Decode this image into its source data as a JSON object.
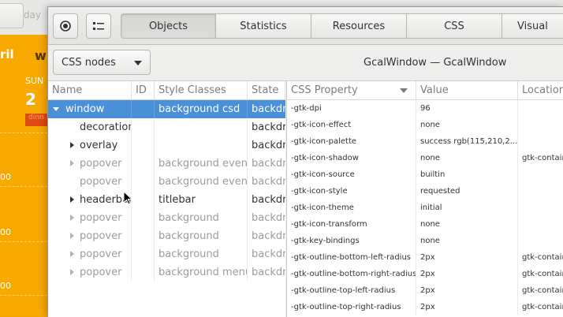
{
  "background_app": {
    "today_label": "day",
    "month_fragment": "ril",
    "view_fragment": "w",
    "day_name": "SUN",
    "day_number": "2",
    "event_fragment": "dinn",
    "hour_fragments": [
      "00",
      "00",
      "00",
      "00"
    ]
  },
  "inspector": {
    "tabs": [
      "Objects",
      "Statistics",
      "Resources",
      "CSS",
      "Visual"
    ],
    "active_tab": "Objects",
    "combo_value": "CSS nodes",
    "window_title": "GcalWindow — GcalWindow",
    "columns": {
      "name": "Name",
      "id": "ID",
      "style_classes": "Style Classes",
      "state": "State"
    },
    "nodes": [
      {
        "name": "window",
        "classes": "background csd",
        "state": "backdrop",
        "expander": "down",
        "selected": true,
        "dim": false
      },
      {
        "name": "decoration",
        "classes": "",
        "state": "backdrop",
        "expander": "none",
        "selected": false,
        "dim": false
      },
      {
        "name": "overlay",
        "classes": "",
        "state": "backdrop",
        "expander": "right",
        "selected": false,
        "dim": false
      },
      {
        "name": "popover",
        "classes": "background events",
        "state": "backdrop",
        "expander": "right",
        "selected": false,
        "dim": true
      },
      {
        "name": "popover",
        "classes": "background events",
        "state": "backdrop",
        "expander": "none",
        "selected": false,
        "dim": true
      },
      {
        "name": "headerbar",
        "classes": "titlebar",
        "state": "backdrop",
        "expander": "right",
        "selected": false,
        "dim": false
      },
      {
        "name": "popover",
        "classes": "background",
        "state": "backdrop",
        "expander": "right",
        "selected": false,
        "dim": true
      },
      {
        "name": "popover",
        "classes": "background",
        "state": "backdrop",
        "expander": "right",
        "selected": false,
        "dim": true
      },
      {
        "name": "popover",
        "classes": "background",
        "state": "backdrop",
        "expander": "right",
        "selected": false,
        "dim": true
      },
      {
        "name": "popover",
        "classes": "background menu",
        "state": "backdrop",
        "expander": "right",
        "selected": false,
        "dim": true
      }
    ],
    "prop_columns": {
      "property": "CSS Property",
      "value": "Value",
      "location": "Location"
    },
    "properties": [
      {
        "property": "-gtk-dpi",
        "value": "96",
        "location": ""
      },
      {
        "property": "-gtk-icon-effect",
        "value": "none",
        "location": ""
      },
      {
        "property": "-gtk-icon-palette",
        "value": "success rgb(115,210,2...",
        "location": ""
      },
      {
        "property": "-gtk-icon-shadow",
        "value": "none",
        "location": "gtk-contained"
      },
      {
        "property": "-gtk-icon-source",
        "value": "builtin",
        "location": ""
      },
      {
        "property": "-gtk-icon-style",
        "value": "requested",
        "location": ""
      },
      {
        "property": "-gtk-icon-theme",
        "value": "initial",
        "location": ""
      },
      {
        "property": "-gtk-icon-transform",
        "value": "none",
        "location": ""
      },
      {
        "property": "-gtk-key-bindings",
        "value": "none",
        "location": ""
      },
      {
        "property": "-gtk-outline-bottom-left-radius",
        "value": "2px",
        "location": "gtk-contained"
      },
      {
        "property": "-gtk-outline-bottom-right-radius",
        "value": "2px",
        "location": "gtk-contained"
      },
      {
        "property": "-gtk-outline-top-left-radius",
        "value": "2px",
        "location": "gtk-contained"
      },
      {
        "property": "-gtk-outline-top-right-radius",
        "value": "2px",
        "location": "gtk-contained"
      }
    ]
  },
  "colors": {
    "selection": "#4a90d9",
    "calendar_bg": "#f5a600"
  },
  "icons": {
    "picker": "crosshair-icon",
    "details": "list-details-icon"
  }
}
